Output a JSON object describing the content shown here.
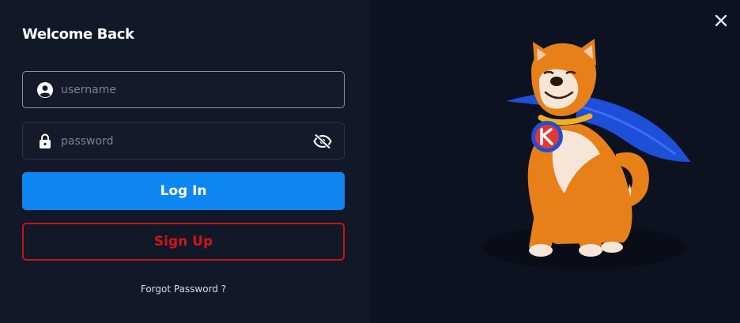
{
  "modal": {
    "title": "Welcome Back",
    "username": {
      "placeholder": "username",
      "value": "",
      "icon": "user-circle-icon"
    },
    "password": {
      "placeholder": "password",
      "value": "",
      "icon": "lock-icon",
      "toggle_icon": "eye-off-icon"
    },
    "login_label": "Log In",
    "signup_label": "Sign Up",
    "forgot_label": "Forgot Password ?",
    "close_icon": "close-icon",
    "illustration": "shiba-superhero-mascot"
  },
  "colors": {
    "panel_bg": "#111827",
    "art_bg": "#0c1220",
    "primary": "#0e86f2",
    "danger": "#c3151b"
  }
}
